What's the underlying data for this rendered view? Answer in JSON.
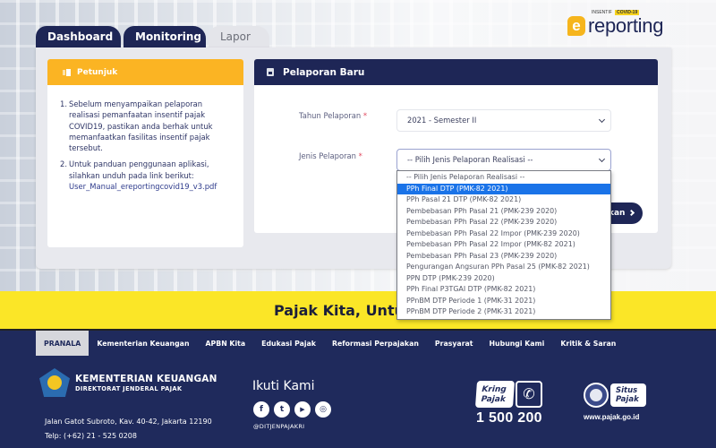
{
  "brand": {
    "logo_letter": "e",
    "logo_tagline": "INSENTIF",
    "logo_badge": "COVID-19",
    "logo_text": "reporting"
  },
  "tabs": [
    {
      "label": "Dashboard",
      "active": false
    },
    {
      "label": "Monitoring",
      "active": false
    },
    {
      "label": "Lapor",
      "active": true
    }
  ],
  "petunjuk": {
    "title": "Petunjuk",
    "items": [
      {
        "num": "1.",
        "text": "Sebelum menyampaikan pelaporan realisasi pemanfaatan insentif pajak COVID19, pastikan anda berhak untuk memanfaatkan fasilitas insentif pajak tersebut."
      },
      {
        "num": "2.",
        "text": "Untuk panduan penggunaan aplikasi, silahkan unduh pada link berikut:",
        "link": "User_Manual_ereportingcovid19_v3.pdf"
      }
    ]
  },
  "form": {
    "title": "Pelaporan Baru",
    "tahun_label": "Tahun Pelaporan",
    "tahun_value": "2021 - Semester II",
    "jenis_label": "Jenis Pelaporan",
    "jenis_value": "-- Pilih Jenis Pelaporan Realisasi --",
    "required_mark": "*",
    "submit_label": "kan"
  },
  "dropdown": {
    "options": [
      "-- Pilih Jenis Pelaporan Realisasi --",
      "PPh Final DTP (PMK-82 2021)",
      "PPh Pasal 21 DTP (PMK-82 2021)",
      "Pembebasan PPh Pasal 21 (PMK-239 2020)",
      "Pembebasan PPh Pasal 22 (PMK-239 2020)",
      "Pembebasan PPh Pasal 22 Impor (PMK-239 2020)",
      "Pembebasan PPh Pasal 22 Impor (PMK-82 2021)",
      "Pembebasan PPh Pasal 23 (PMK-239 2020)",
      "Pengurangan Angsuran PPh Pasal 25 (PMK-82 2021)",
      "PPN DTP (PMK-239 2020)",
      "PPh Final P3TGAI DTP (PMK-82 2021)",
      "PPnBM DTP Periode 1 (PMK-31 2021)",
      "PPnBM DTP Periode 2 (PMK-31 2021)"
    ],
    "highlighted_index": 1
  },
  "banner": {
    "text": "Pajak Kita, Untuk"
  },
  "footer": {
    "nav": [
      {
        "label": "PRANALA",
        "active": true
      },
      {
        "label": "Kementerian Keuangan"
      },
      {
        "label": "APBN Kita"
      },
      {
        "label": "Edukasi Pajak"
      },
      {
        "label": "Reformasi Perpajakan"
      },
      {
        "label": "Prasyarat"
      },
      {
        "label": "Hubungi Kami"
      },
      {
        "label": "Kritik & Saran"
      }
    ],
    "org_name": "KEMENTERIAN KEUANGAN",
    "org_sub": "DIREKTORAT JENDERAL PAJAK",
    "address": "Jalan Gatot Subroto, Kav. 40-42, Jakarta 12190",
    "phone": "Telp: (+62) 21 - 525 0208",
    "follow_title": "Ikuti Kami",
    "socials": [
      {
        "icon": "facebook-icon",
        "glyph": "f"
      },
      {
        "icon": "twitter-icon",
        "glyph": "t"
      },
      {
        "icon": "youtube-icon",
        "glyph": "▶"
      },
      {
        "icon": "instagram-icon",
        "glyph": "◎"
      }
    ],
    "handle": "@DITJENPAJAKRI",
    "kring_line1": "Kring",
    "kring_line2": "Pajak",
    "kring_phone_glyph": "✆",
    "kring_number": "1 500 200",
    "situs_line1": "Situs",
    "situs_line2": "Pajak",
    "situs_url": "www.pajak.go.id"
  }
}
